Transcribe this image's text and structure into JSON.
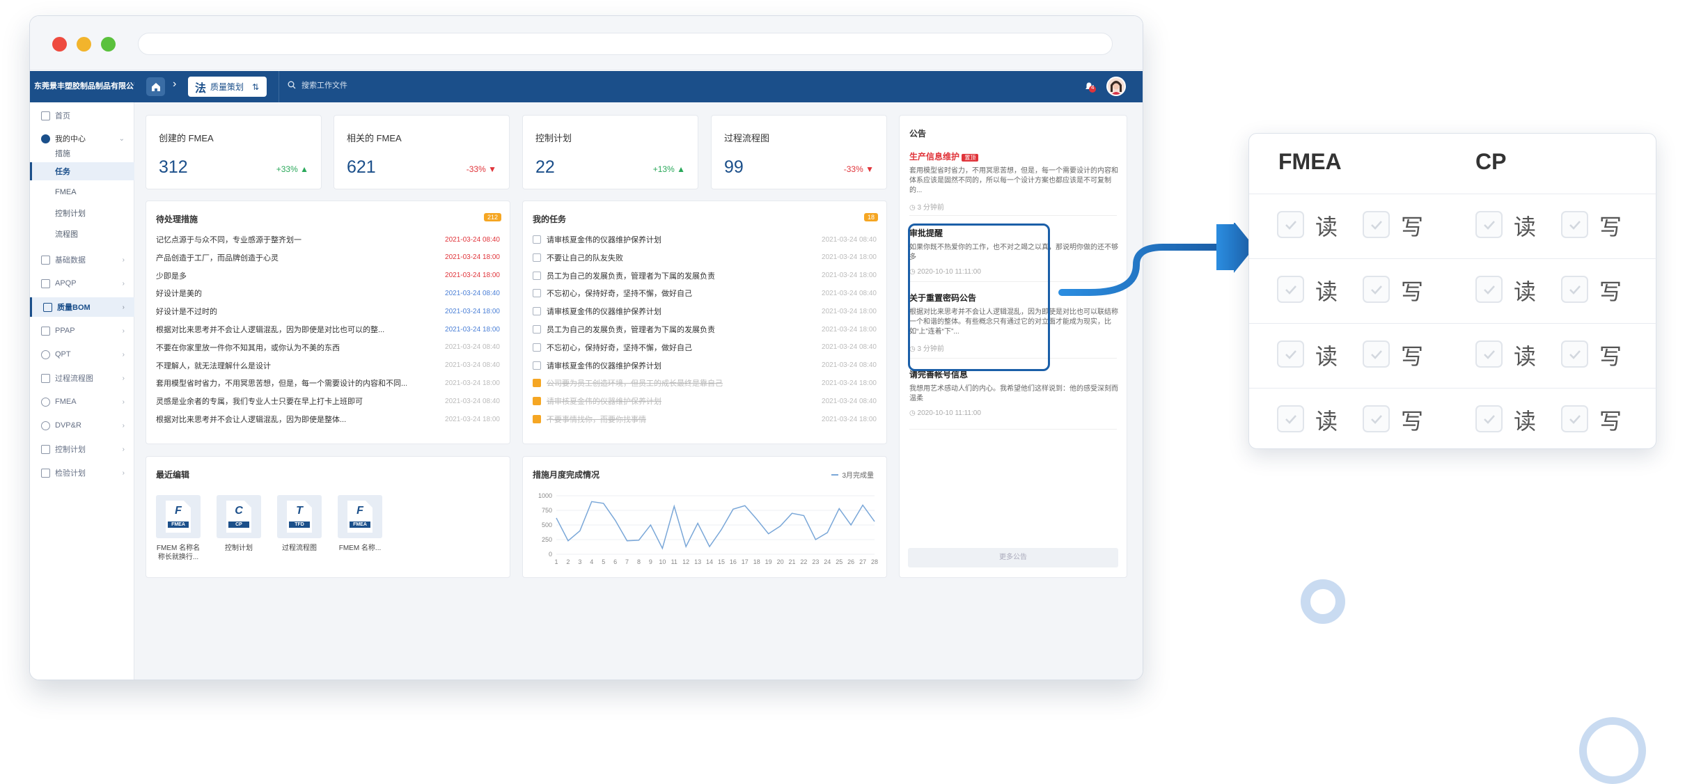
{
  "company": "东莞景丰塑胶制品制品有限公司",
  "module": {
    "icon": "法",
    "label": "质量策划"
  },
  "search_placeholder": "搜索工作文件",
  "notif_count": "4",
  "sidebar": {
    "items": [
      {
        "label": "首页"
      },
      {
        "label": "我的中心"
      },
      {
        "label": "基础数据"
      },
      {
        "label": "APQP"
      },
      {
        "label": "质量BOM"
      },
      {
        "label": "PPAP"
      },
      {
        "label": "QPT"
      },
      {
        "label": "过程流程图"
      },
      {
        "label": "FMEA"
      },
      {
        "label": "DVP&R"
      },
      {
        "label": "控制计划"
      },
      {
        "label": "检验计划"
      }
    ],
    "sub": [
      {
        "label": "措施"
      },
      {
        "label": "任务"
      },
      {
        "label": "FMEA"
      },
      {
        "label": "控制计划"
      },
      {
        "label": "流程图"
      }
    ]
  },
  "stats": [
    {
      "label": "创建的 FMEA",
      "value": "312",
      "change": "+33%",
      "dir": "up"
    },
    {
      "label": "相关的 FMEA",
      "value": "621",
      "change": "-33%",
      "dir": "down"
    },
    {
      "label": "控制计划",
      "value": "22",
      "change": "+13%",
      "dir": "up"
    },
    {
      "label": "过程流程图",
      "value": "99",
      "change": "-33%",
      "dir": "down"
    }
  ],
  "pending": {
    "title": "待处理措施",
    "count": "212",
    "rows": [
      {
        "text": "记忆点源于与众不同，专业感源于整齐划一",
        "date": "2021-03-24 08:40",
        "color": "red"
      },
      {
        "text": "产品创造于工厂，而品牌创造于心灵",
        "date": "2021-03-24 18:00",
        "color": "red"
      },
      {
        "text": "少即是多",
        "date": "2021-03-24 18:00",
        "color": "red"
      },
      {
        "text": "好设计是美的",
        "date": "2021-03-24 08:40",
        "color": "blue"
      },
      {
        "text": "好设计是不过时的",
        "date": "2021-03-24 18:00",
        "color": "blue"
      },
      {
        "text": "根据对比来思考并不会让人逻辑混乱，因为即使是对比也可以的整...",
        "date": "2021-03-24 18:00",
        "color": "blue"
      },
      {
        "text": "不要在你家里放一件你不知其用，或你认为不美的东西",
        "date": "2021-03-24 08:40",
        "color": "gray"
      },
      {
        "text": "不理解人，就无法理解什么是设计",
        "date": "2021-03-24 08:40",
        "color": "gray"
      },
      {
        "text": "套用模型省时省力，不用冥思苦想，但是，每一个需要设计的内容和不同...",
        "date": "2021-03-24 18:00",
        "color": "gray"
      },
      {
        "text": "灵感是业余者的专属，我们专业人士只要在早上打卡上班即可",
        "date": "2021-03-24 08:40",
        "color": "gray"
      },
      {
        "text": "根据对比来思考并不会让人逻辑混乱，因为即使是整体...",
        "date": "2021-03-24 18:00",
        "color": "gray"
      }
    ]
  },
  "tasks": {
    "title": "我的任务",
    "count": "18",
    "rows": [
      {
        "text": "请审核夏金伟的仪器维护保养计划",
        "date": "2021-03-24 08:40",
        "done": false
      },
      {
        "text": "不要让自己的队友失败",
        "date": "2021-03-24 18:00",
        "done": false
      },
      {
        "text": "员工为自己的发展负责，管理者为下属的发展负责",
        "date": "2021-03-24 18:00",
        "done": false
      },
      {
        "text": "不忘初心，保持好奇，坚持不懈，做好自己",
        "date": "2021-03-24 08:40",
        "done": false
      },
      {
        "text": "请审核夏金伟的仪器维护保养计划",
        "date": "2021-03-24 18:00",
        "done": false
      },
      {
        "text": "员工为自己的发展负责，管理者为下属的发展负责",
        "date": "2021-03-24 18:00",
        "done": false
      },
      {
        "text": "不忘初心，保持好奇，坚持不懈，做好自己",
        "date": "2021-03-24 08:40",
        "done": false
      },
      {
        "text": "请审核夏金伟的仪器维护保养计划",
        "date": "2021-03-24 08:40",
        "done": false
      },
      {
        "text": "公司要为员工创造环境，但员工的成长最终是靠自己",
        "date": "2021-03-24 18:00",
        "done": true
      },
      {
        "text": "请审核夏金伟的仪器维护保养计划",
        "date": "2021-03-24 08:40",
        "done": true
      },
      {
        "text": "不要事情找你，而要你找事情",
        "date": "2021-03-24 18:00",
        "done": true
      }
    ]
  },
  "recent": {
    "title": "最近编辑",
    "files": [
      {
        "letter": "F",
        "tag": "FMEA",
        "name": "FMEM 名称名称长就换行..."
      },
      {
        "letter": "C",
        "tag": "CP",
        "name": "控制计划"
      },
      {
        "letter": "T",
        "tag": "TFD",
        "name": "过程流程图"
      },
      {
        "letter": "F",
        "tag": "FMEA",
        "name": "FMEM 名称..."
      }
    ]
  },
  "chart_data": {
    "type": "line",
    "title": "措施月度完成情况",
    "series": [
      {
        "name": "3月完成量",
        "values": [
          620,
          230,
          400,
          900,
          870,
          580,
          230,
          240,
          500,
          100,
          820,
          130,
          530,
          130,
          420,
          770,
          830,
          600,
          350,
          480,
          700,
          660,
          250,
          370,
          780,
          500,
          840,
          560
        ]
      }
    ],
    "categories": [
      "1",
      "2",
      "3",
      "4",
      "5",
      "6",
      "7",
      "8",
      "9",
      "10",
      "11",
      "12",
      "13",
      "14",
      "15",
      "16",
      "17",
      "18",
      "19",
      "20",
      "21",
      "22",
      "23",
      "24",
      "25",
      "26",
      "27",
      "28"
    ],
    "yticks": [
      "1000",
      "750",
      "500",
      "250",
      "0"
    ],
    "ylim": [
      0,
      1000
    ],
    "color": "#7aa7d8"
  },
  "announcements": {
    "title": "公告",
    "more": "更多公告",
    "items": [
      {
        "title": "生产信息维护",
        "tag": "置顶",
        "body": "套用模型省时省力，不用冥思苦想，但是，每一个需要设计的内容和体系应该是固然不同的，所以每一个设计方案也都应该是不可复制的...",
        "time": "3 分钟前"
      },
      {
        "title": "审批提醒",
        "body": "如果你既不热爱你的工作，也不对之竭之以真，那说明你做的还不够多",
        "time": "2020-10-10 11:11:00"
      },
      {
        "title": "关于重置密码公告",
        "body": "根据对比来思考并不会让人逻辑混乱，因为即使是对比也可以联结称一个和谐的整体。有些概念只有通过它的对立面才能成为现实，比如“上”连着“下”...",
        "time": "3 分钟前"
      },
      {
        "title": "请完善帐号信息",
        "body": "我想用艺术感动人们的内心。我希望他们这样说到：他的感受深刻而温柔",
        "time": "2020-10-10 11:11:00"
      }
    ]
  },
  "permissions": {
    "headers": [
      "FMEA",
      "CP"
    ],
    "read": "读",
    "write": "写"
  }
}
